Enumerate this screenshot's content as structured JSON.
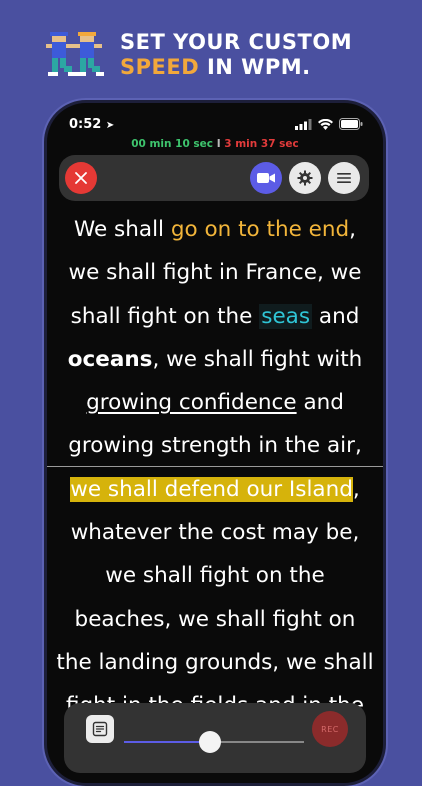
{
  "banner": {
    "headline_line1": "SET YOUR CUSTOM",
    "headline_accent": "SPEED",
    "headline_rest": " IN WPM.",
    "icon": "running-people-icon",
    "accent_color": "#f2a83b",
    "background_color": "#4a50a0"
  },
  "status_bar": {
    "time": "0:52",
    "icons": [
      "location-arrow-icon",
      "signal-bars-icon",
      "wifi-icon",
      "battery-icon"
    ]
  },
  "timer": {
    "elapsed": "00 min 10 sec",
    "separator": "I",
    "remaining": "3 min 37 sec",
    "elapsed_color": "#3ec46d",
    "remaining_color": "#e23b3b"
  },
  "toolbar": {
    "close_icon": "close-icon",
    "video_icon": "video-camera-icon",
    "settings_icon": "gear-icon",
    "menu_icon": "hamburger-menu-icon"
  },
  "script": {
    "l1a": "We shall ",
    "l1b": "go on to the end",
    "l1c": ",",
    "l2": "we shall fight in France, we",
    "l3a": "shall fight on the ",
    "l3b": "seas",
    "l3c": " and",
    "l4a": "oceans",
    "l4b": ", we shall fight with",
    "l5a": "growing confidence",
    "l5b": " and",
    "l6": "growing strength in the air,",
    "l7a": "we shall defend our Island",
    "l7b": ",",
    "l8": "whatever the cost may be,",
    "l9": "we shall fight on the",
    "l10": "beaches, we shall fight on",
    "l11": "the landing grounds, we shall",
    "l12": "fight in the fields and in the"
  },
  "controls": {
    "notes_icon": "notes-icon",
    "rec_label": "REC",
    "speed_fraction": 0.48
  }
}
